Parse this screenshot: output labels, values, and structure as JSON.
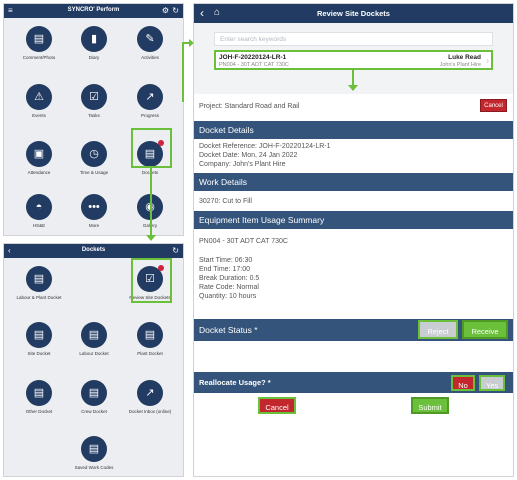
{
  "home": {
    "title": "SYNCRO' Perform",
    "tiles": [
      {
        "label": "Comment/Photo",
        "icon": "▤"
      },
      {
        "label": "Diary",
        "icon": "▮"
      },
      {
        "label": "Activities",
        "icon": "✎"
      },
      {
        "label": "Events",
        "icon": "⚠"
      },
      {
        "label": "Tasks",
        "icon": "☑"
      },
      {
        "label": "Progress",
        "icon": "↗"
      },
      {
        "label": "Attendance",
        "icon": "▣"
      },
      {
        "label": "Time & Usage",
        "icon": "◷"
      },
      {
        "label": "Dockets",
        "icon": "▤"
      },
      {
        "label": "HS&E",
        "icon": "◓"
      },
      {
        "label": "More",
        "icon": "•••"
      },
      {
        "label": "Gallery",
        "icon": "◉"
      }
    ]
  },
  "dockets": {
    "title": "Dockets",
    "tiles": [
      {
        "label": "Labour & Plant Docket",
        "icon": "▤"
      },
      {
        "label": "Review Site Dockets",
        "icon": "☑"
      },
      {
        "label": "Site Docket",
        "icon": "▤"
      },
      {
        "label": "Labour Docket",
        "icon": "▤"
      },
      {
        "label": "Plant Docket",
        "icon": "▤"
      },
      {
        "label": "Other Docket",
        "icon": "▤"
      },
      {
        "label": "Crew Docket",
        "icon": "▤"
      },
      {
        "label": "Docket Inbox (online)",
        "icon": "↗"
      },
      {
        "label": "Saved Work Codes",
        "icon": "▤"
      }
    ]
  },
  "review": {
    "title": "Review Site Dockets",
    "search_placeholder": "Enter search keywords",
    "item": {
      "ref": "JOH-F-20220124-LR-1",
      "sub": "PN004 - 30T ADT CAT 730C",
      "person": "Luke Read",
      "company": "John's Plant Hire"
    }
  },
  "form": {
    "project": "Project: Standard Road and Rail",
    "cancel_top": "Cancel",
    "docket_details_header": "Docket Details",
    "docket_ref": "Docket Reference: JOH-F-20220124-LR-1",
    "docket_date": "Docket Date: Mon, 24 Jan 2022",
    "company": "Company: John's Plant Hire",
    "work_details_header": "Work Details",
    "work_code": "30270: Cut to Fill",
    "equipment_header": "Equipment Item Usage Summary",
    "equipment": "PN004 - 30T ADT CAT 730C",
    "start": "Start Time: 06:30",
    "end": "End Time: 17:00",
    "break": "Break Duration: 0.5",
    "rate": "Rate Code: Normal",
    "quantity": "Quantity: 10 hours",
    "status_header": "Docket Status *",
    "reject": "Reject",
    "receive": "Receive",
    "reallocate": "Reallocate Usage? *",
    "no": "No",
    "yes": "Yes",
    "cancel": "Cancel",
    "submit": "Submit"
  },
  "colors": {
    "navy": "#213b62",
    "section": "#34547b",
    "green": "#6abf3b",
    "red": "#c1272d"
  }
}
